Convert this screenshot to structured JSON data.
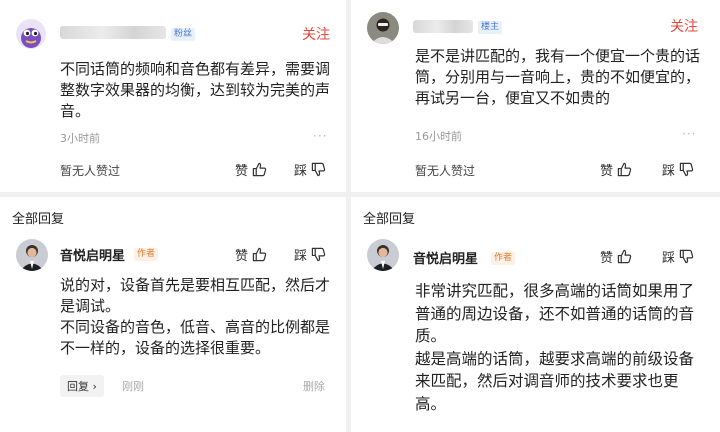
{
  "comment1": {
    "badge": "粉丝",
    "follow": "关注",
    "text": "不同话筒的频响和音色都有差异，需要调整数字效果器的均衡，达到较为完美的声音。",
    "time": "3小时前",
    "more": "···",
    "likes_summary": "暂无人赞过",
    "like_label": "赞",
    "dislike_label": "踩"
  },
  "comment2": {
    "badge": "楼主",
    "follow": "关注",
    "text": "是不是讲匹配的，我有一个便宜一个贵的话筒，分别用与一音响上，贵的不如便宜的，再试另一台，便宜又不如贵的",
    "time": "16小时前",
    "more": "···",
    "likes_summary": "暂无人赞过",
    "like_label": "赞",
    "dislike_label": "踩"
  },
  "reply1": {
    "section_title": "全部回复",
    "username": "音悦启明星",
    "author_tag": "作者",
    "like_label": "赞",
    "dislike_label": "踩",
    "paragraphs": [
      "说的对，设备首先是要相互匹配，然后才是调试。",
      "不同设备的音色，低音、高音的比例都是不一样的，设备的选择很重要。"
    ],
    "reply_label": "回复 ›",
    "time": "刚刚",
    "delete_label": "删除"
  },
  "reply2": {
    "section_title": "全部回复",
    "username": "音悦启明星",
    "author_tag": "作者",
    "like_label": "赞",
    "dislike_label": "踩",
    "paragraphs": [
      "非常讲究匹配，很多高端的话筒如果用了普通的周边设备，还不如普通的话筒的音质。",
      "越是高端的话筒，越要求高端的前级设备来匹配，然后对调音师的技术要求也更高。"
    ]
  },
  "colors": {
    "follow": "#e8483c",
    "badge_blue": "#4a7bd0",
    "author_orange": "#e07a2e"
  },
  "icons": [
    "thumbs-up-icon",
    "thumbs-down-icon",
    "avatar-purple-cartoon",
    "avatar-user-photo",
    "avatar-author-photo"
  ]
}
